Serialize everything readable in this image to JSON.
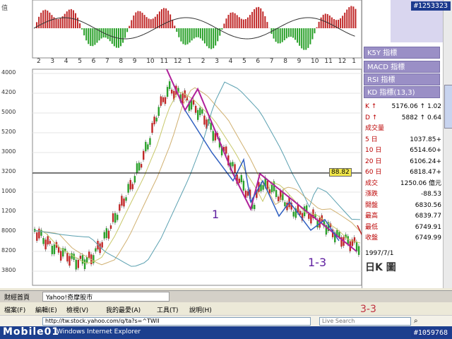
{
  "watermark_top_right": "#1253323",
  "watermark_bottom_right": "#1059768",
  "logo_bottom_left": "Mobile01",
  "top_strip": {
    "x_months": [
      "2",
      "3",
      "4",
      "5",
      "6",
      "7",
      "8",
      "9",
      "10",
      "11",
      "12",
      "1",
      "2",
      "3",
      "4",
      "5",
      "6",
      "7",
      "8",
      "9",
      "10",
      "11",
      "12",
      "1"
    ]
  },
  "main_chart": {
    "yaxis_labels": [
      "4000",
      "4200",
      "5000",
      "5200",
      "3000",
      "3200",
      "1000",
      "1200",
      "8000",
      "8200",
      "3800"
    ],
    "annotation_1": "1",
    "annotation_2": "1-3",
    "annotation_3": "3-3",
    "price_tag": "88.82"
  },
  "right_panel": {
    "buttons": [
      "MACD 指標",
      "RSI 指標",
      "KD 指標(13,3)",
      "K5Y 指標"
    ],
    "rows": [
      {
        "k": "K ↑",
        "v": "5176.06 ↑ 1.02"
      },
      {
        "k": "D ↑",
        "v": "5882 ↑ 0.64"
      },
      {
        "k": "成交量",
        "v": ""
      },
      {
        "k": "5 日",
        "v": "1037.85+"
      },
      {
        "k": "10 日",
        "v": "6514.60+"
      },
      {
        "k": "20 日",
        "v": "6106.24+"
      },
      {
        "k": "60 日",
        "v": "6818.47+"
      },
      {
        "k": "成交",
        "v": "1250.06 億元"
      },
      {
        "k": "漲跌",
        "v": "-88.53"
      },
      {
        "k": "開盤",
        "v": "6830.56"
      },
      {
        "k": "最高",
        "v": "6839.77"
      },
      {
        "k": "最低",
        "v": "6749.91"
      },
      {
        "k": "收盤",
        "v": "6749.99"
      }
    ],
    "date": "1997/7/1",
    "section_label": "日K 圖"
  },
  "browser": {
    "tabs": [
      "財經首頁",
      "Yahoo!奇摩股市"
    ],
    "menus": [
      "檔案(F)",
      "編輯(E)",
      "檢視(V)",
      "我的最愛(A)",
      "工具(T)",
      "說明(H)"
    ],
    "address": "http://tw.stock.yahoo.com/q/ta?s=^TWII",
    "search_placeholder": "Live Search",
    "status_text": "Windows Internet Explorer"
  }
}
